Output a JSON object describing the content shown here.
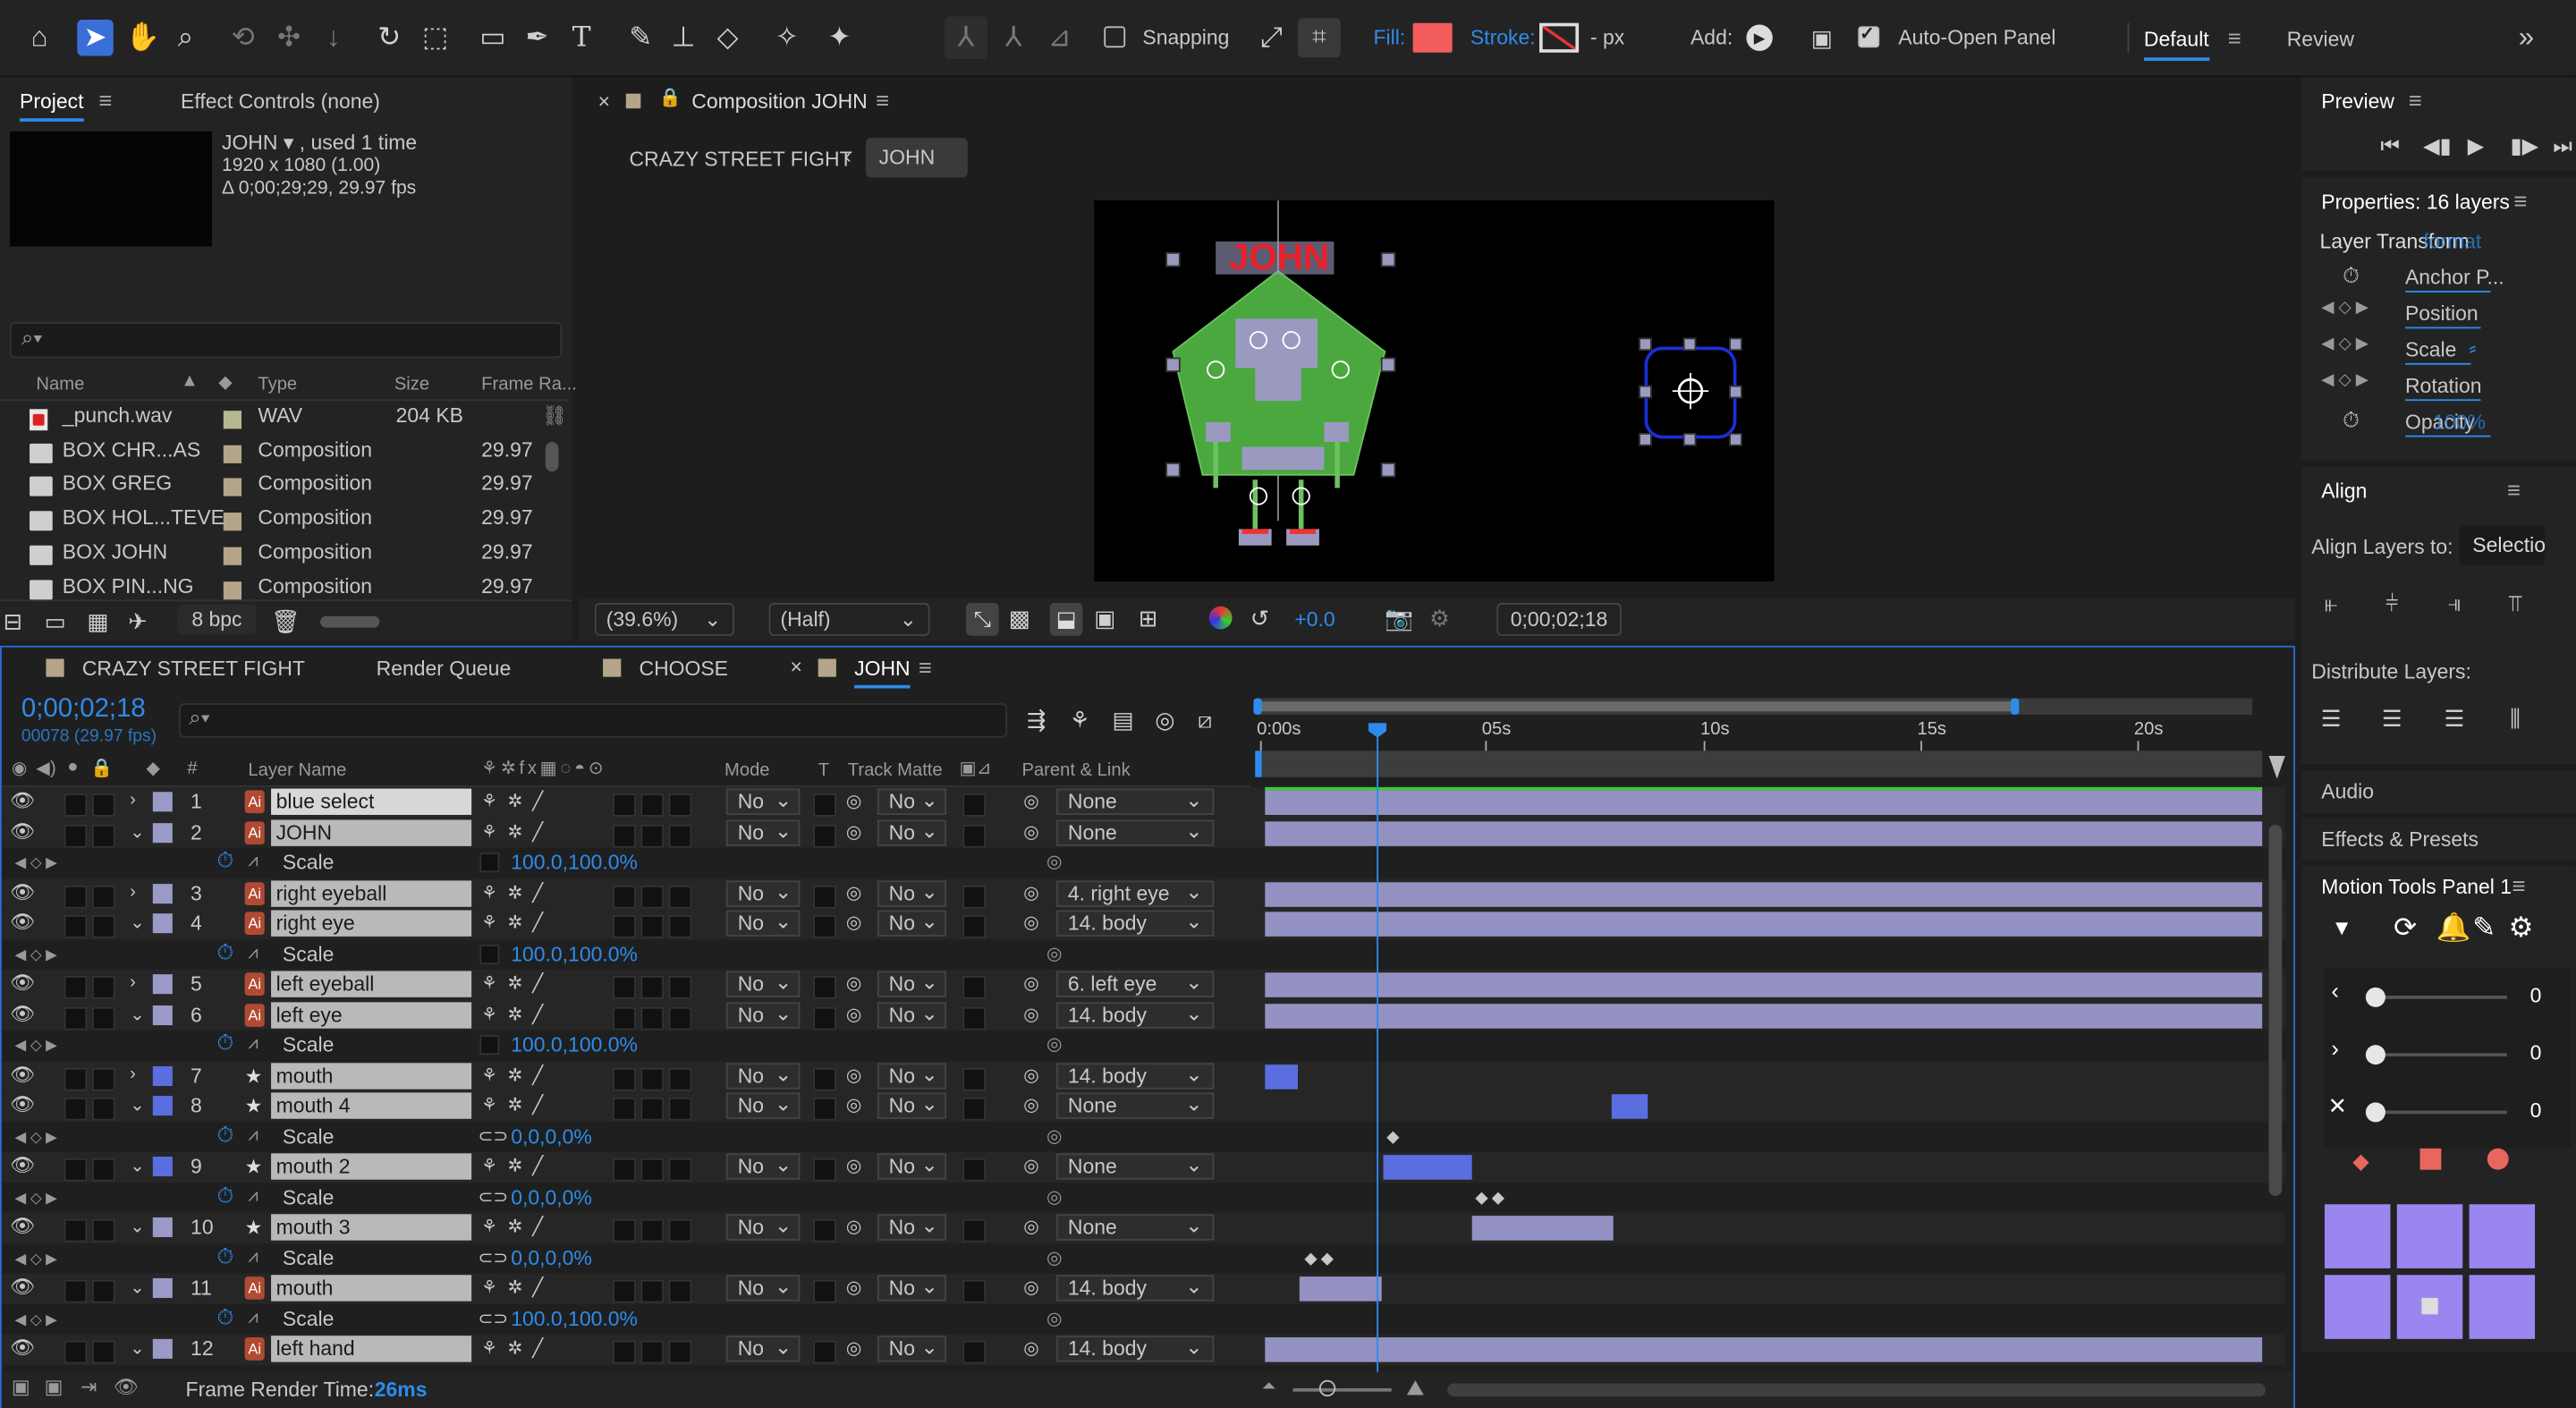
{
  "toolbar": {
    "snapping": "Snapping",
    "fill": "Fill:",
    "stroke": "Stroke:",
    "stroke_px": "- px",
    "add": "Add:",
    "auto_open_panel": "Auto-Open Panel",
    "workspace_default": "Default",
    "workspace_review": "Review",
    "fill_color": "#f25c5c"
  },
  "project": {
    "tab_project": "Project",
    "tab_effect_controls": "Effect Controls (none)",
    "item_name": "JOHN ▾ , used 1 time",
    "item_size": "1920 x 1080 (1.00)",
    "item_duration": "Δ 0;00;29;29, 29.97 fps",
    "columns": {
      "name": "Name",
      "type": "Type",
      "size": "Size",
      "frame_rate": "Frame Ra..."
    },
    "rows": [
      {
        "name": "_punch.wav",
        "type": "WAV",
        "size": "204 KB",
        "fps": "",
        "color": "#b7b78f"
      },
      {
        "name": "BOX CHR...AS",
        "type": "Composition",
        "size": "",
        "fps": "29.97",
        "color": "#b4a58a"
      },
      {
        "name": "BOX GREG",
        "type": "Composition",
        "size": "",
        "fps": "29.97",
        "color": "#b4a58a"
      },
      {
        "name": "BOX HOL...TEVE",
        "type": "Composition",
        "size": "",
        "fps": "29.97",
        "color": "#b4a58a"
      },
      {
        "name": "BOX JOHN",
        "type": "Composition",
        "size": "",
        "fps": "29.97",
        "color": "#b4a58a"
      },
      {
        "name": "BOX PIN...NG",
        "type": "Composition",
        "size": "",
        "fps": "29.97",
        "color": "#b4a58a"
      }
    ],
    "bpc": "8 bpc"
  },
  "composition": {
    "tab_label": "Composition JOHN",
    "breadcrumb_parent": "CRAZY STREET FIGHT",
    "breadcrumb_current": "JOHN",
    "title_text": "JOHN",
    "zoom": "(39.6%)",
    "resolution": "(Half)",
    "exposure": "+0.0",
    "timecode": "0;00;02;18"
  },
  "preview": {
    "title": "Preview"
  },
  "properties": {
    "title": "Properties: 16 layers",
    "section": "Layer Transform",
    "section_overlap": "format",
    "anchor": "Anchor P...",
    "position": "Position",
    "scale": "Scale",
    "rotation": "Rotation",
    "opacity": "Opacity",
    "opacity_value": "100%"
  },
  "align": {
    "title": "Align",
    "align_to_label": "Align Layers to:",
    "align_to_value": "Selectio",
    "distribute": "Distribute Layers:"
  },
  "side_panels": {
    "audio": "Audio",
    "effects": "Effects & Presets",
    "motion_tools": "Motion Tools Panel 1",
    "slider_values": [
      "0",
      "0",
      "0"
    ]
  },
  "timeline": {
    "tabs": [
      "CRAZY STREET FIGHT",
      "Render Queue",
      "CHOOSE",
      "JOHN"
    ],
    "timecode": "0;00;02;18",
    "frame_info": "00078 (29.97 fps)",
    "col_layer_name": "Layer Name",
    "col_mode": "Mode",
    "col_t": "T",
    "col_track_matte": "Track Matte",
    "col_parent": "Parent & Link",
    "ruler": [
      "0:00s",
      "05s",
      "10s",
      "15s",
      "20s"
    ],
    "frame_render_label": "Frame Render Time:",
    "frame_render_value": "26ms",
    "rows": [
      {
        "kind": "layer",
        "num": "1",
        "name": "blue select",
        "parent": "None",
        "label": "#9a9ac8",
        "expanded": false,
        "star": false
      },
      {
        "kind": "layer",
        "num": "2",
        "name": "JOHN",
        "parent": "None",
        "label": "#9a9ac8",
        "expanded": true,
        "star": false
      },
      {
        "kind": "prop",
        "name": "Scale",
        "value": "100.0,100.0%",
        "link": false
      },
      {
        "kind": "layer",
        "num": "3",
        "name": "right eyeball",
        "parent": "4. right eye",
        "label": "#9a9ac8",
        "expanded": false,
        "star": false
      },
      {
        "kind": "layer",
        "num": "4",
        "name": "right eye",
        "parent": "14. body",
        "label": "#9a9ac8",
        "expanded": true,
        "star": false
      },
      {
        "kind": "prop",
        "name": "Scale",
        "value": "100.0,100.0%",
        "link": false
      },
      {
        "kind": "layer",
        "num": "5",
        "name": "left eyeball",
        "parent": "6. left eye",
        "label": "#9a9ac8",
        "expanded": false,
        "star": false
      },
      {
        "kind": "layer",
        "num": "6",
        "name": "left eye",
        "parent": "14. body",
        "label": "#9a9ac8",
        "expanded": true,
        "star": false
      },
      {
        "kind": "prop",
        "name": "Scale",
        "value": "100.0,100.0%",
        "link": false
      },
      {
        "kind": "layer",
        "num": "7",
        "name": "mouth",
        "parent": "14. body",
        "label": "#5a6ee0",
        "expanded": false,
        "star": true
      },
      {
        "kind": "layer",
        "num": "8",
        "name": "mouth 4",
        "parent": "None",
        "label": "#5a6ee0",
        "expanded": true,
        "star": true
      },
      {
        "kind": "prop",
        "name": "Scale",
        "value": "0,0,0,0%",
        "link": true
      },
      {
        "kind": "layer",
        "num": "9",
        "name": "mouth 2",
        "parent": "None",
        "label": "#5a6ee0",
        "expanded": true,
        "star": true
      },
      {
        "kind": "prop",
        "name": "Scale",
        "value": "0,0,0,0%",
        "link": true
      },
      {
        "kind": "layer",
        "num": "10",
        "name": "mouth 3",
        "parent": "None",
        "label": "#9a9ac8",
        "expanded": true,
        "star": true
      },
      {
        "kind": "prop",
        "name": "Scale",
        "value": "0,0,0,0%",
        "link": true
      },
      {
        "kind": "layer",
        "num": "11",
        "name": "mouth",
        "parent": "14. body",
        "label": "#9a9ac8",
        "expanded": true,
        "star": false
      },
      {
        "kind": "prop",
        "name": "Scale",
        "value": "100.0,100.0%",
        "link": true
      },
      {
        "kind": "layer",
        "num": "12",
        "name": "left hand",
        "parent": "14. body",
        "label": "#9a9ac8",
        "expanded": true,
        "star": false
      }
    ]
  }
}
